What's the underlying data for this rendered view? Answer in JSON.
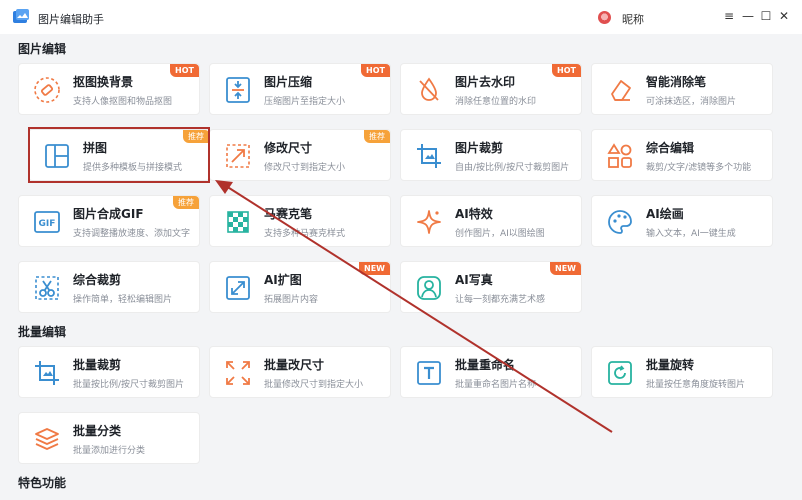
{
  "window": {
    "title": "图片编辑助手",
    "user_name": "昵称",
    "controls": [
      "≡",
      "—",
      "☐",
      "✕"
    ]
  },
  "sections": {
    "edit": "图片编辑",
    "batch": "批量编辑",
    "special": "特色功能"
  },
  "edit_tools": [
    {
      "name": "抠图换背景",
      "desc": "支持人像抠图和物品抠图",
      "badge": "HOT",
      "icon": "eraser-icon"
    },
    {
      "name": "图片压缩",
      "desc": "压缩图片至指定大小",
      "badge": "HOT",
      "icon": "compress-icon"
    },
    {
      "name": "图片去水印",
      "desc": "消除任意位置的水印",
      "badge": "HOT",
      "icon": "drop-slash-icon"
    },
    {
      "name": "智能消除笔",
      "desc": "可涂抹选区，消除图片",
      "badge": "",
      "icon": "smart-eraser-icon"
    },
    {
      "name": "拼图",
      "desc": "提供多种模板与拼接模式",
      "badge": "推荐",
      "icon": "collage-icon"
    },
    {
      "name": "修改尺寸",
      "desc": "修改尺寸到指定大小",
      "badge": "推荐",
      "icon": "resize-icon"
    },
    {
      "name": "图片裁剪",
      "desc": "自由/按比例/按尺寸裁剪图片",
      "badge": "",
      "icon": "crop-icon"
    },
    {
      "name": "综合编辑",
      "desc": "裁剪/文字/滤镜等多个功能",
      "badge": "",
      "icon": "shapes-icon"
    },
    {
      "name": "图片合成GIF",
      "desc": "支持调整播放速度、添加文字",
      "badge": "推荐",
      "icon": "gif-icon"
    },
    {
      "name": "马赛克笔",
      "desc": "支持多种马赛克样式",
      "badge": "",
      "icon": "mosaic-icon"
    },
    {
      "name": "AI特效",
      "desc": "创作图片，AI以图绘图",
      "badge": "",
      "icon": "sparkle-icon"
    },
    {
      "name": "AI绘画",
      "desc": "输入文本，AI一键生成",
      "badge": "",
      "icon": "palette-icon"
    },
    {
      "name": "综合裁剪",
      "desc": "操作简单，轻松编辑图片",
      "badge": "",
      "icon": "scissors-icon"
    },
    {
      "name": "AI扩图",
      "desc": "拓展图片内容",
      "badge": "NEW",
      "icon": "expand-icon"
    },
    {
      "name": "AI写真",
      "desc": "让每一刻都充满艺术感",
      "badge": "NEW",
      "icon": "portrait-icon"
    }
  ],
  "batch_tools": [
    {
      "name": "批量裁剪",
      "desc": "批量按比例/按尺寸裁剪图片",
      "badge": "",
      "icon": "batch-crop-icon"
    },
    {
      "name": "批量改尺寸",
      "desc": "批量修改尺寸到指定大小",
      "badge": "",
      "icon": "batch-resize-icon"
    },
    {
      "name": "批量重命名",
      "desc": "批量重命名图片名称",
      "badge": "",
      "icon": "batch-rename-icon"
    },
    {
      "name": "批量旋转",
      "desc": "批量按任意角度旋转图片",
      "badge": "",
      "icon": "batch-rotate-icon"
    },
    {
      "name": "批量分类",
      "desc": "批量添加进行分类",
      "badge": "",
      "icon": "batch-sort-icon"
    }
  ],
  "colors": {
    "accent": "#f06a35",
    "badge_recommend": "#f6a23a",
    "highlight": "#b0322c",
    "icon_blue": "#3a8ed0",
    "icon_orange": "#f07a45",
    "icon_teal": "#27b3a0"
  }
}
